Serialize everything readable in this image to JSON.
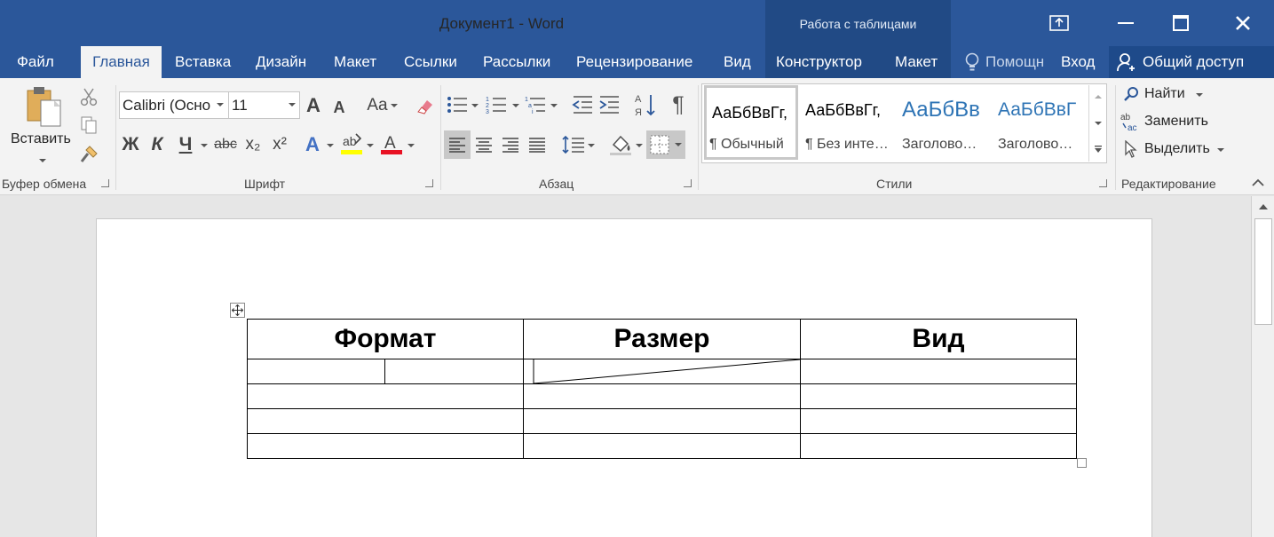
{
  "window": {
    "title": "Документ1 - Word",
    "context_group": "Работа с таблицами"
  },
  "tabs": [
    {
      "label": "Файл",
      "active": false
    },
    {
      "label": "Главная",
      "active": true
    },
    {
      "label": "Вставка",
      "active": false
    },
    {
      "label": "Дизайн",
      "active": false
    },
    {
      "label": "Макет",
      "active": false
    },
    {
      "label": "Ссылки",
      "active": false
    },
    {
      "label": "Рассылки",
      "active": false
    },
    {
      "label": "Рецензирование",
      "active": false
    },
    {
      "label": "Вид",
      "active": false
    },
    {
      "label": "Конструктор",
      "active": false
    },
    {
      "label": "Макет",
      "active": false
    }
  ],
  "tell_me": "Помощн",
  "signin": "Вход",
  "share": "Общий доступ",
  "ribbon": {
    "clipboard": {
      "paste_label": "Вставить",
      "group_label": "Буфер обмена"
    },
    "font": {
      "font_name": "Calibri (Осно",
      "font_size": "11",
      "group_label": "Шрифт",
      "bold": "Ж",
      "italic": "К",
      "underline": "Ч",
      "strike": "abc",
      "sub": "x₂",
      "sup": "x²",
      "change_case": "Aa"
    },
    "paragraph": {
      "group_label": "Абзац"
    },
    "styles": {
      "group_label": "Стили",
      "items": [
        {
          "sample": "АаБбВвГг,",
          "name": "¶ Обычный"
        },
        {
          "sample": "АаБбВвГг,",
          "name": "¶ Без инте…"
        },
        {
          "sample": "АаБбВв",
          "name": "Заголово…"
        },
        {
          "sample": "АаБбВвГ",
          "name": "Заголово…"
        }
      ]
    },
    "editing": {
      "group_label": "Редактирование",
      "find": "Найти",
      "replace": "Заменить",
      "select": "Выделить"
    }
  },
  "document": {
    "table": {
      "headers": [
        "Формат",
        "Размер",
        "Вид"
      ],
      "empty_rows": 4
    }
  },
  "colors": {
    "accent": "#2b579a",
    "ctx_group": "#214a85",
    "highlight": "#ffff00",
    "font_color": "#e81123"
  }
}
